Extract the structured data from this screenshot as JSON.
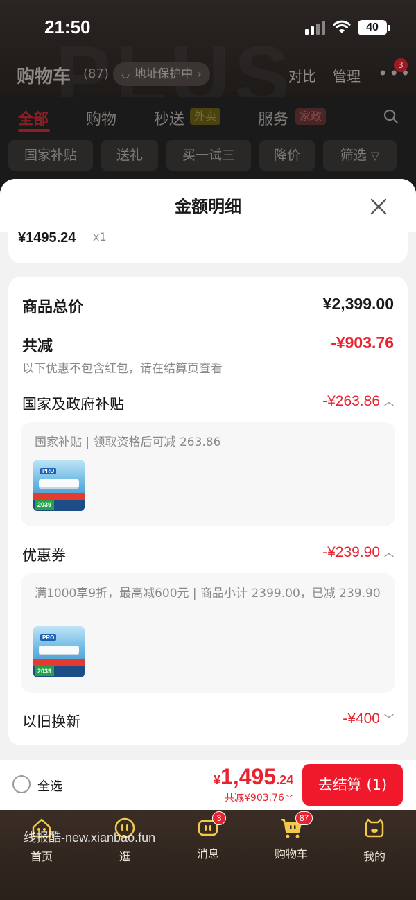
{
  "status_bar": {
    "time": "21:50",
    "battery": "40"
  },
  "cart_header": {
    "title": "购物车",
    "count": "(87)",
    "address_protect": "地址保护中",
    "compare": "对比",
    "manage": "管理",
    "more_badge": "3"
  },
  "categories": [
    {
      "label": "全部"
    },
    {
      "label": "购物"
    },
    {
      "label": "秒送",
      "tag": "外卖"
    },
    {
      "label": "服务",
      "tag": "家政"
    }
  ],
  "filters": [
    "国家补贴",
    "送礼",
    "买一试三",
    "降价",
    "筛选"
  ],
  "sheet": {
    "title": "金额明细",
    "item_price": "¥1495.24",
    "item_qty": "x1",
    "total_label": "商品总价",
    "total_value": "¥2,399.00",
    "reduce_label": "共减",
    "reduce_value": "-¥903.76",
    "reduce_note": "以下优惠不包含红包，请在结算页查看",
    "subsidy_label": "国家及政府补贴",
    "subsidy_value": "-¥263.86",
    "subsidy_detail": "国家补贴 | 领取资格后可减 263.86",
    "coupon_label": "优惠券",
    "coupon_value": "-¥239.90",
    "coupon_detail": "满1000享9折，最高减600元 | 商品小计 2399.00，已减 239.90",
    "tradein_label": "以旧换新",
    "tradein_value": "-¥400"
  },
  "thumb": {
    "badge": "PRO",
    "price_tag": "2039"
  },
  "action_bar": {
    "select_all": "全选",
    "currency": "¥",
    "price_int": "1,495",
    "price_dec": ".24",
    "discount": "共减¥903.76",
    "checkout": "去结算 (1)"
  },
  "tab_bar": {
    "items": [
      {
        "label": "首页"
      },
      {
        "label": "逛"
      },
      {
        "label": "消息",
        "badge": "3"
      },
      {
        "label": "购物车",
        "badge": "87"
      },
      {
        "label": "我的"
      }
    ],
    "watermark": "线报酷-new.xianbao.fun"
  },
  "colors": {
    "accent_red": "#e8222f",
    "checkout_red": "#f0192b",
    "tabbar_brown": "#3a2d24"
  }
}
